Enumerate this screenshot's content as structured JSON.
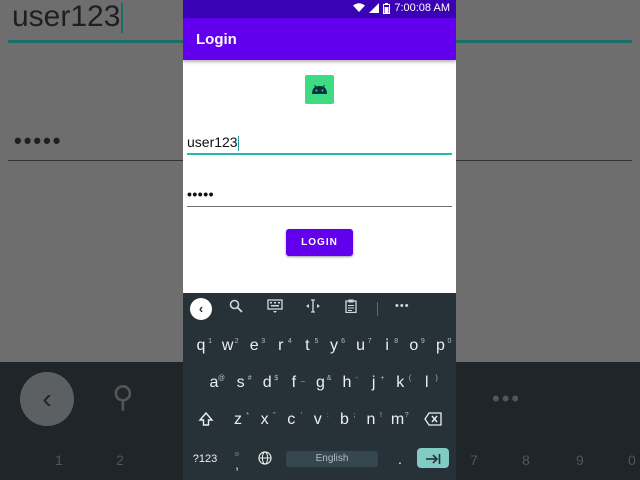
{
  "status_bar": {
    "time": "7:00:08 AM"
  },
  "app_bar": {
    "title": "Login"
  },
  "username": {
    "value": "user123"
  },
  "password": {
    "value": "•••••"
  },
  "login_button": {
    "label": "LOGIN"
  },
  "keyboard": {
    "row1": [
      {
        "key": "q",
        "hint": "1"
      },
      {
        "key": "w",
        "hint": "2"
      },
      {
        "key": "e",
        "hint": "3"
      },
      {
        "key": "r",
        "hint": "4"
      },
      {
        "key": "t",
        "hint": "5"
      },
      {
        "key": "y",
        "hint": "6"
      },
      {
        "key": "u",
        "hint": "7"
      },
      {
        "key": "i",
        "hint": "8"
      },
      {
        "key": "o",
        "hint": "9"
      },
      {
        "key": "p",
        "hint": "0"
      }
    ],
    "row2": [
      {
        "key": "a",
        "hint": "@"
      },
      {
        "key": "s",
        "hint": "#"
      },
      {
        "key": "d",
        "hint": "$"
      },
      {
        "key": "f",
        "hint": "_"
      },
      {
        "key": "g",
        "hint": "&"
      },
      {
        "key": "h",
        "hint": "-"
      },
      {
        "key": "j",
        "hint": "+"
      },
      {
        "key": "k",
        "hint": "("
      },
      {
        "key": "l",
        "hint": ")"
      }
    ],
    "row3": [
      {
        "key": "z",
        "hint": "*"
      },
      {
        "key": "x",
        "hint": "\""
      },
      {
        "key": "c",
        "hint": "'"
      },
      {
        "key": "v",
        "hint": ":"
      },
      {
        "key": "b",
        "hint": ";"
      },
      {
        "key": "n",
        "hint": "!"
      },
      {
        "key": "m",
        "hint": "?"
      }
    ],
    "symbols_label": "?123",
    "comma": ",",
    "space_label": "English",
    "period": "."
  },
  "background": {
    "username_text": "user123",
    "password_text": "•••••",
    "number_hints": [
      "1",
      "2",
      "7",
      "8",
      "9",
      "0"
    ]
  },
  "colors": {
    "status_bar": "#3a02b5",
    "app_bar": "#6200ee",
    "accent": "#26b8a9",
    "keyboard": "#263238",
    "android_logo": "#3ddc84"
  }
}
